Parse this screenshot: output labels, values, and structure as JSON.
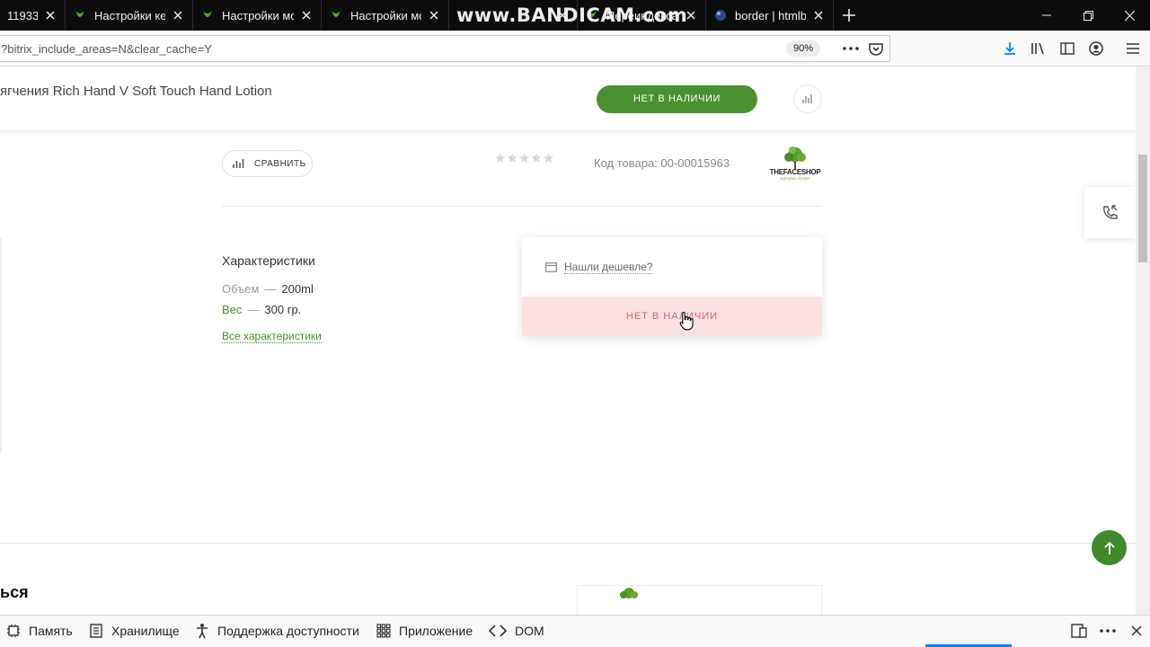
{
  "browser": {
    "tabs": [
      {
        "title": "11933 -"
      },
      {
        "title": "Настройки ке"
      },
      {
        "title": "Настройки мо"
      },
      {
        "title": "Настройки мо"
      },
      {
        "title": ""
      },
      {
        "title": "Переиндексац"
      },
      {
        "title": "border | htmlbo"
      }
    ],
    "watermark": "www.BANDICAM.com",
    "url": "?bitrix_include_areas=N&clear_cache=Y",
    "zoom": "90%"
  },
  "page": {
    "sticky_title": "ягчения Rich Hand V Soft Touch Hand Lotion",
    "sticky_button": "НЕТ В НАЛИЧИИ",
    "compare_label": "СРАВНИТЬ",
    "stars": "★★★★★",
    "rating": 0,
    "sku": "Код товара: 00-00015963",
    "brand": "THEFACESHOP",
    "brand_sub": "NATURAL STORY",
    "characteristics_title": "Характеристики",
    "characteristics": [
      {
        "key": "Объем",
        "value": "200ml"
      },
      {
        "key": "Вес",
        "value": "300 гр."
      }
    ],
    "dash": "—",
    "all_characteristics": "Все характеристики",
    "cheaper_label": "Нашли дешевле?",
    "out_of_stock": "НЕТ В НАЛИЧИИ",
    "section_heading_fragment": "ься"
  },
  "devtools": {
    "tabs": [
      {
        "label": "Память",
        "icon": "memory-icon"
      },
      {
        "label": "Хранилище",
        "icon": "storage-icon"
      },
      {
        "label": "Поддержка доступности",
        "icon": "accessibility-icon"
      },
      {
        "label": "Приложение",
        "icon": "application-icon"
      },
      {
        "label": "DOM",
        "icon": "dom-icon"
      }
    ]
  },
  "colors": {
    "accent_green": "#4a9131",
    "out_of_stock_bg": "#fbe1e1",
    "out_of_stock_text": "#cc6b6b"
  }
}
